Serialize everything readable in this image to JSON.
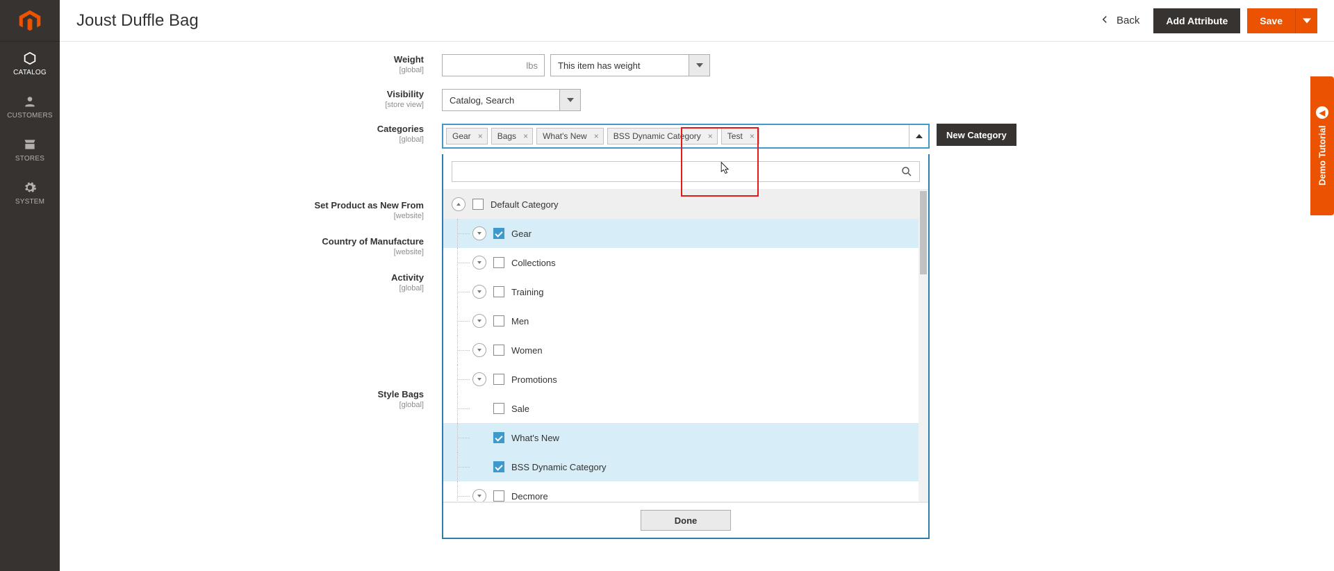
{
  "header": {
    "title": "Joust Duffle Bag",
    "back": "Back",
    "add_attribute": "Add Attribute",
    "save": "Save"
  },
  "sidebar": {
    "items": [
      {
        "label": "CATALOG",
        "icon": "cube"
      },
      {
        "label": "CUSTOMERS",
        "icon": "person"
      },
      {
        "label": "STORES",
        "icon": "storefront"
      },
      {
        "label": "SYSTEM",
        "icon": "gear"
      }
    ]
  },
  "form": {
    "weight": {
      "label": "Weight",
      "scope": "[global]",
      "suffix": "lbs",
      "value": "",
      "weight_select": "This item has weight"
    },
    "visibility": {
      "label": "Visibility",
      "scope": "[store view]",
      "value": "Catalog, Search"
    },
    "categories": {
      "label": "Categories",
      "scope": "[global]",
      "tokens": [
        "Gear",
        "Bags",
        "What's New",
        "BSS Dynamic Category",
        "Test"
      ],
      "new_button": "New Category",
      "search_placeholder": "",
      "done": "Done",
      "tree": [
        {
          "label": "Default Category",
          "level": 0,
          "checked": false,
          "expandable": true,
          "sel": false,
          "open": true
        },
        {
          "label": "Gear",
          "level": 1,
          "checked": true,
          "expandable": true,
          "sel": true
        },
        {
          "label": "Collections",
          "level": 1,
          "checked": false,
          "expandable": true,
          "sel": false
        },
        {
          "label": "Training",
          "level": 1,
          "checked": false,
          "expandable": true,
          "sel": false
        },
        {
          "label": "Men",
          "level": 1,
          "checked": false,
          "expandable": true,
          "sel": false
        },
        {
          "label": "Women",
          "level": 1,
          "checked": false,
          "expandable": true,
          "sel": false
        },
        {
          "label": "Promotions",
          "level": 1,
          "checked": false,
          "expandable": true,
          "sel": false
        },
        {
          "label": "Sale",
          "level": 1,
          "checked": false,
          "expandable": false,
          "sel": false
        },
        {
          "label": "What's New",
          "level": 1,
          "checked": true,
          "expandable": false,
          "sel": true
        },
        {
          "label": "BSS Dynamic Category",
          "level": 1,
          "checked": true,
          "expandable": false,
          "sel": true
        },
        {
          "label": "Decmore",
          "level": 1,
          "checked": false,
          "expandable": true,
          "sel": false
        }
      ]
    },
    "new_from": {
      "label": "Set Product as New From",
      "scope": "[website]"
    },
    "country": {
      "label": "Country of Manufacture",
      "scope": "[website]"
    },
    "activity": {
      "label": "Activity",
      "scope": "[global]"
    },
    "style": {
      "label": "Style Bags",
      "scope": "[global]"
    }
  },
  "tutorial_tab": "Demo Tutorial"
}
